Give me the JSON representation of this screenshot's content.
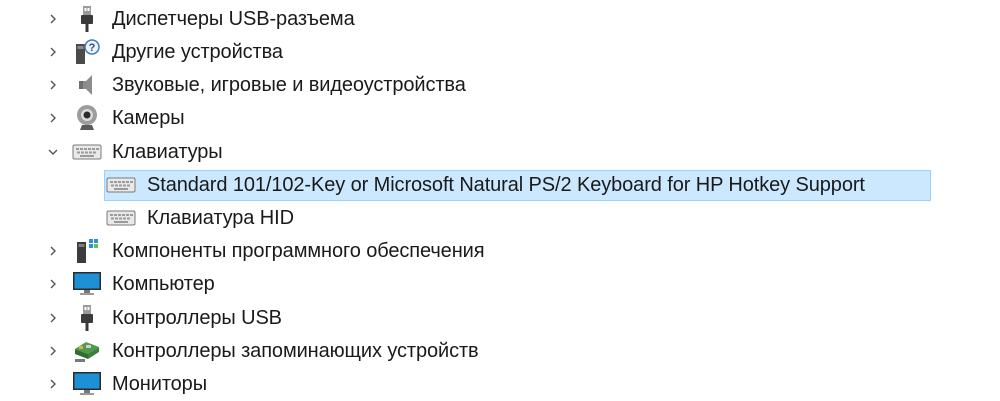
{
  "tree": {
    "items": [
      {
        "label": "Диспетчеры USB-разъема",
        "icon": "usb-plug-icon",
        "expanded": false
      },
      {
        "label": "Другие устройства",
        "icon": "unknown-device-icon",
        "expanded": false
      },
      {
        "label": "Звуковые, игровые и видеоустройства",
        "icon": "speaker-icon",
        "expanded": false
      },
      {
        "label": "Камеры",
        "icon": "webcam-icon",
        "expanded": false
      },
      {
        "label": "Клавиатуры",
        "icon": "keyboard-icon",
        "expanded": true
      },
      {
        "label": "Standard 101/102-Key or Microsoft Natural PS/2 Keyboard for HP Hotkey Support",
        "icon": "keyboard-icon",
        "child": true,
        "selected": true
      },
      {
        "label": "Клавиатура HID",
        "icon": "keyboard-icon",
        "child": true
      },
      {
        "label": "Компоненты программного обеспечения",
        "icon": "software-component-icon",
        "expanded": false
      },
      {
        "label": "Компьютер",
        "icon": "computer-monitor-icon",
        "expanded": false
      },
      {
        "label": "Контроллеры USB",
        "icon": "usb-plug-icon",
        "expanded": false
      },
      {
        "label": "Контроллеры запоминающих устройств",
        "icon": "storage-controller-icon",
        "expanded": false
      },
      {
        "label": "Мониторы",
        "icon": "computer-monitor-icon",
        "expanded": false
      }
    ]
  },
  "colors": {
    "selection_bg": "#cce8ff",
    "selection_border": "#99d1ff",
    "monitor_blue": "#1e90d6"
  }
}
